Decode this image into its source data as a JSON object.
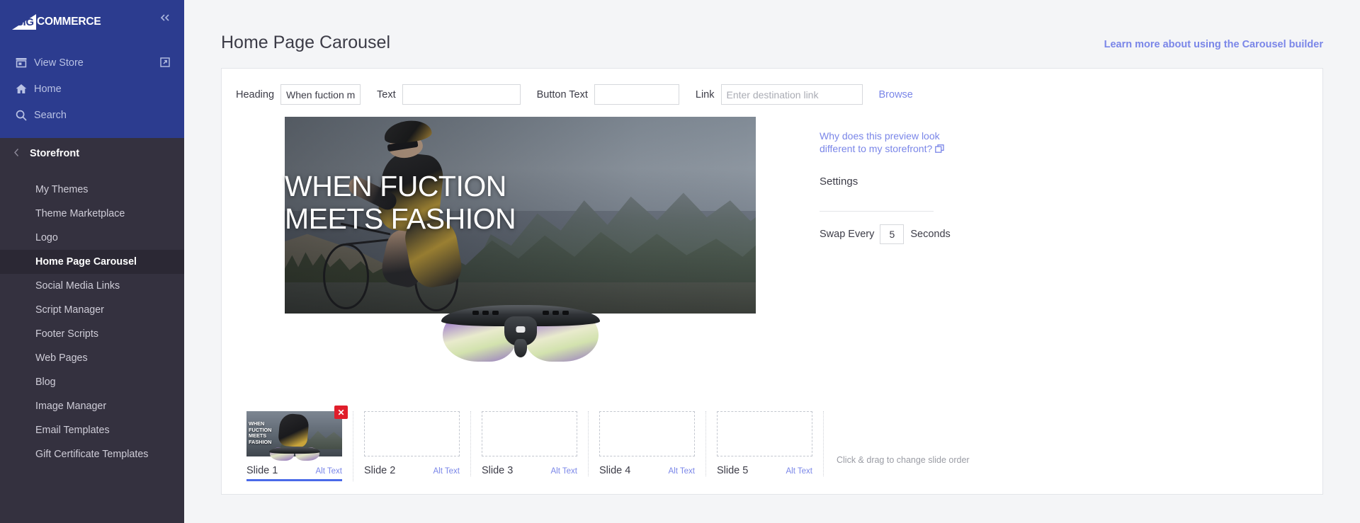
{
  "brand": {
    "logo_big": "BIG",
    "logo_commerce": "COMMERCE",
    "collapse_icon": "double-chevron-left-icon"
  },
  "sidebar": {
    "top_nav": [
      {
        "label": "View Store",
        "icon": "store-icon",
        "trailing_icon": "external-link-icon"
      },
      {
        "label": "Home",
        "icon": "home-icon"
      },
      {
        "label": "Search",
        "icon": "search-icon"
      }
    ],
    "section": {
      "label": "Storefront",
      "back_icon": "chevron-left-icon"
    },
    "items": [
      {
        "label": "My Themes",
        "active": false
      },
      {
        "label": "Theme Marketplace",
        "active": false
      },
      {
        "label": "Logo",
        "active": false
      },
      {
        "label": "Home Page Carousel",
        "active": true
      },
      {
        "label": "Social Media Links",
        "active": false
      },
      {
        "label": "Script Manager",
        "active": false
      },
      {
        "label": "Footer Scripts",
        "active": false
      },
      {
        "label": "Web Pages",
        "active": false
      },
      {
        "label": "Blog",
        "active": false
      },
      {
        "label": "Image Manager",
        "active": false
      },
      {
        "label": "Email Templates",
        "active": false
      },
      {
        "label": "Gift Certificate Templates",
        "active": false
      }
    ]
  },
  "header": {
    "title": "Home Page Carousel",
    "learn_more_link": "Learn more about using the Carousel builder"
  },
  "form": {
    "heading_label": "Heading",
    "heading_value": "When fuction meets fasl",
    "text_label": "Text",
    "text_value": "",
    "text_placeholder": "",
    "button_text_label": "Button Text",
    "button_text_value": "",
    "button_text_placeholder": "",
    "link_label": "Link",
    "link_value": "",
    "link_placeholder": "Enter destination link",
    "browse_label": "Browse"
  },
  "preview": {
    "banner_heading": "WHEN FUCTION\nMEETS FASHION",
    "why_link": "Why does this preview look different to my storefront?",
    "why_link_icon": "external-window-icon",
    "settings_label": "Settings",
    "swap_every_label": "Swap Every",
    "swap_every_value": "5",
    "seconds_label": "Seconds"
  },
  "slides": {
    "drag_hint": "Click & drag to change slide order",
    "alt_text_label": "Alt Text",
    "delete_icon": "close-x-icon",
    "items": [
      {
        "name": "Slide 1",
        "filled": true,
        "active": true,
        "thumb_text": "WHEN\nFUCTION\nMEETS\nFASHION"
      },
      {
        "name": "Slide 2",
        "filled": false,
        "active": false,
        "thumb_text": ""
      },
      {
        "name": "Slide 3",
        "filled": false,
        "active": false,
        "thumb_text": ""
      },
      {
        "name": "Slide 4",
        "filled": false,
        "active": false,
        "thumb_text": ""
      },
      {
        "name": "Slide 5",
        "filled": false,
        "active": false,
        "thumb_text": ""
      }
    ]
  },
  "colors": {
    "sidebar_top": "#2c3c8f",
    "sidebar_body": "#34313f",
    "sidebar_active": "#2b2834",
    "accent_link": "#7a86e8",
    "active_underline": "#4a6ae8",
    "delete_red": "#e01e2b",
    "page_bg": "#f4f5f7"
  }
}
